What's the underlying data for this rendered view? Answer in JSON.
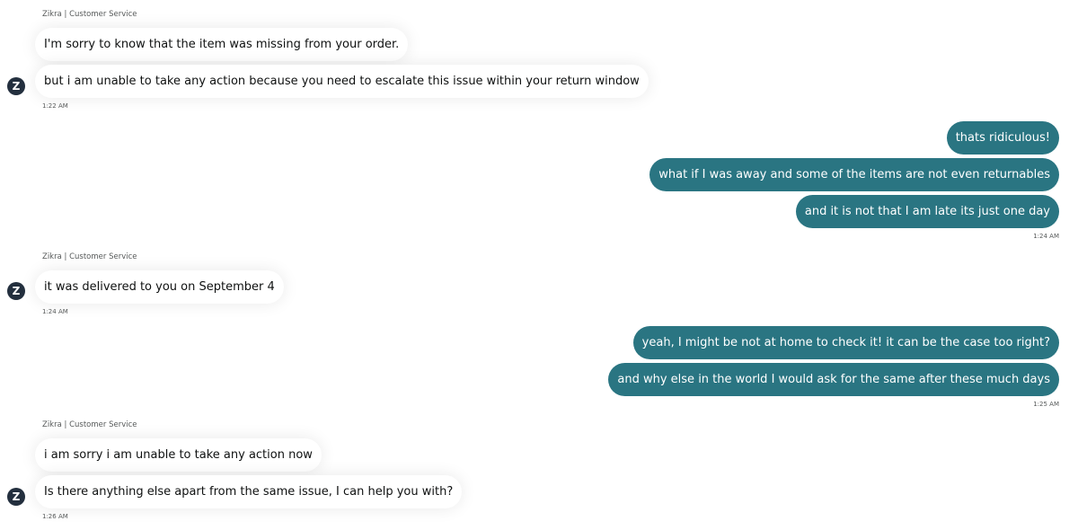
{
  "agent_name": "Zikra | Customer Service",
  "agent_initial": "Z",
  "groups": [
    {
      "side": "agent",
      "sender": "Zikra | Customer Service",
      "messages": [
        "I'm sorry to know that the item was missing from your order.",
        "but i am unable to take any action because you need to escalate this issue within your return window"
      ],
      "time": "1:22 AM"
    },
    {
      "side": "user",
      "messages": [
        "thats ridiculous!",
        "what if I was away and some of the items are not even returnables",
        "and it is not that I am late its just one day"
      ],
      "time": "1:24 AM"
    },
    {
      "side": "agent",
      "sender": "Zikra | Customer Service",
      "messages": [
        "it was delivered to you on September 4"
      ],
      "time": "1:24 AM"
    },
    {
      "side": "user",
      "messages": [
        "yeah, I might be not at home to check it! it can be the case too right?",
        "and why else in the world I would ask for the same after these much days"
      ],
      "time": "1:25 AM"
    },
    {
      "side": "agent",
      "sender": "Zikra | Customer Service",
      "messages": [
        "i am sorry i am unable to take any action now",
        "Is there anything else apart from the same issue, I can help you with?"
      ],
      "time": "1:26 AM"
    }
  ],
  "colors": {
    "user_bubble": "#2a7582",
    "agent_bubble": "#ffffff",
    "avatar": "#232f3e",
    "meta_text": "#565959"
  }
}
